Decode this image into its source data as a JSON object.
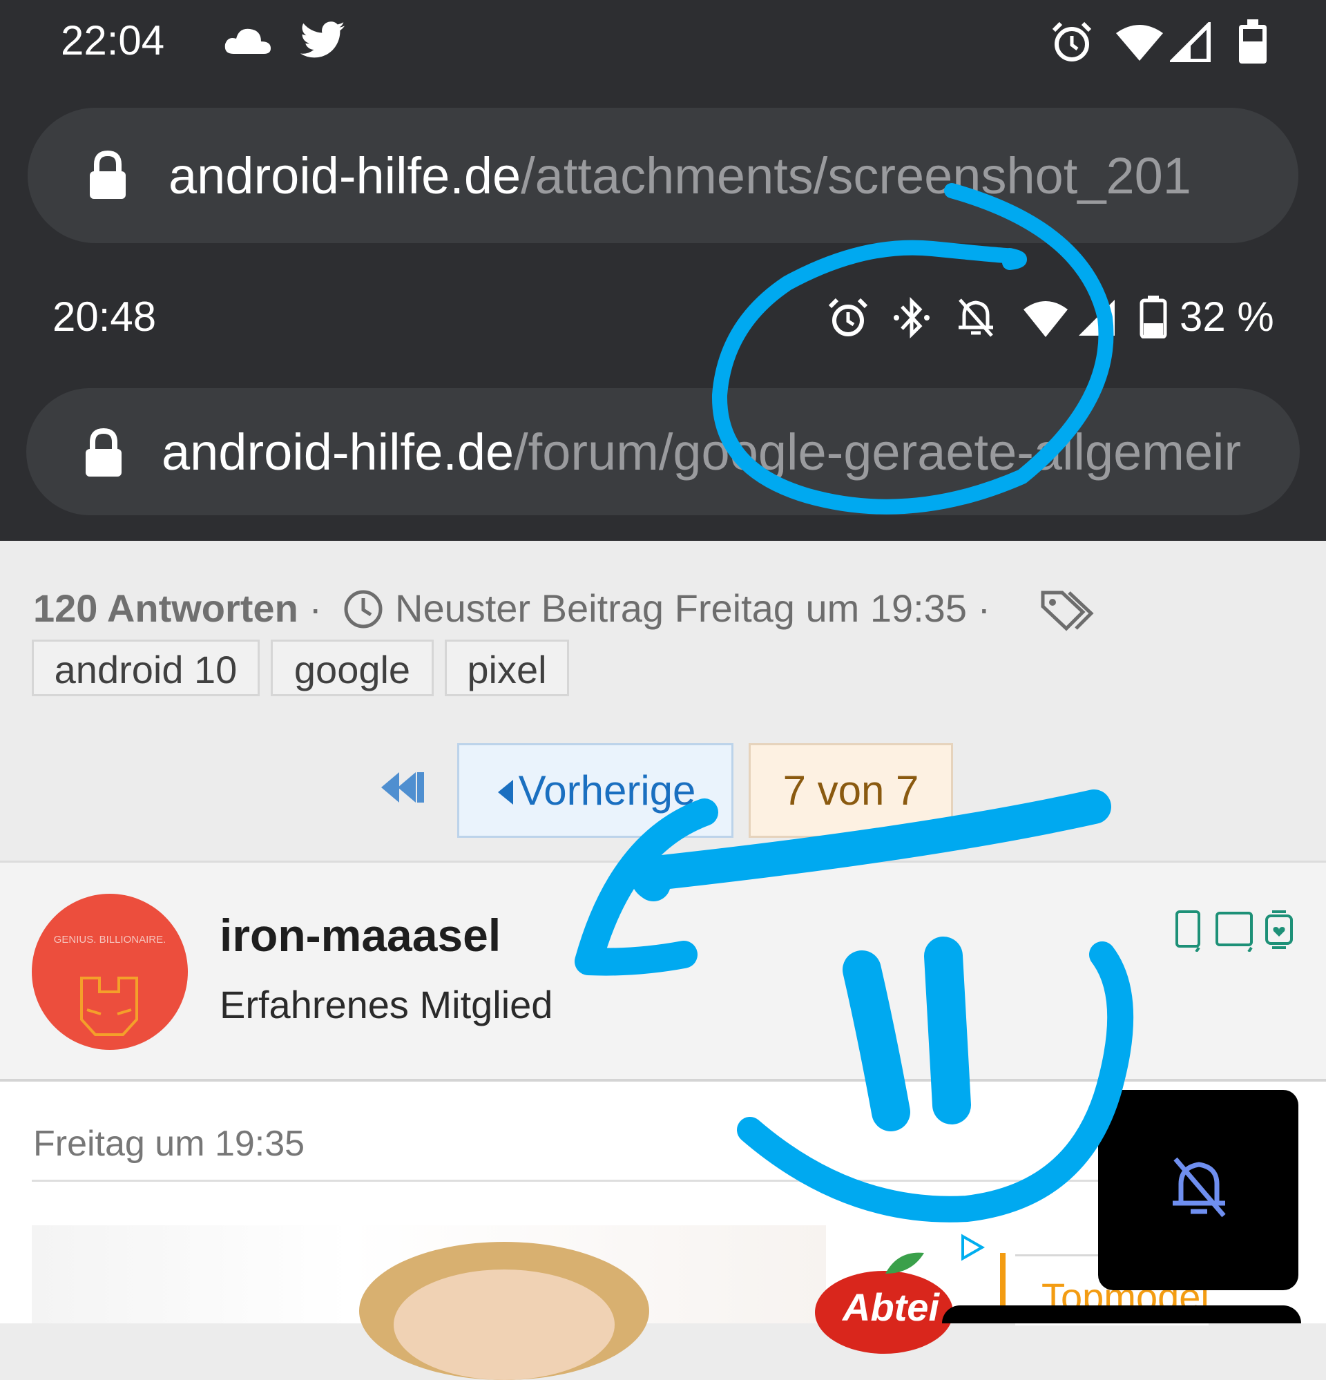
{
  "outer_status": {
    "time": "22:04",
    "icons": [
      "cloud-icon",
      "twitter-icon",
      "alarm-icon",
      "wifi-icon",
      "signal-icon",
      "battery-icon"
    ]
  },
  "outer_url": {
    "host": "android-hilfe.de",
    "path": "/attachments/screenshot_201"
  },
  "inner_status": {
    "time": "20:48",
    "battery": "32 %",
    "icons": [
      "alarm-icon",
      "bluetooth-icon",
      "notifications-off-icon",
      "wifi-icon",
      "signal-icon",
      "battery-icon"
    ]
  },
  "inner_url": {
    "host": "android-hilfe.de",
    "path": "/forum/google-geraete-allgemeir"
  },
  "thread_meta": {
    "answers": "120 Antworten",
    "latest": "Neuster Beitrag Freitag um 19:35"
  },
  "tags": [
    "android 10",
    "google",
    "pixel"
  ],
  "pagination": {
    "prev": "Vorherige",
    "current": "7 von 7"
  },
  "user": {
    "name": "iron-maaasel",
    "rank": "Erfahrenes Mitglied",
    "avatar_text": "GENIUS. BILLIONAIRE."
  },
  "post": {
    "date": "Freitag um 19:35",
    "ad_brand": "Abtei",
    "ad_text": "Topmodelz"
  },
  "colors": {
    "annotation": "#00a9f0",
    "accent_link": "#1a6fc0",
    "current_page_text": "#8a5a10",
    "avatar_bg": "#ec4e3d"
  }
}
